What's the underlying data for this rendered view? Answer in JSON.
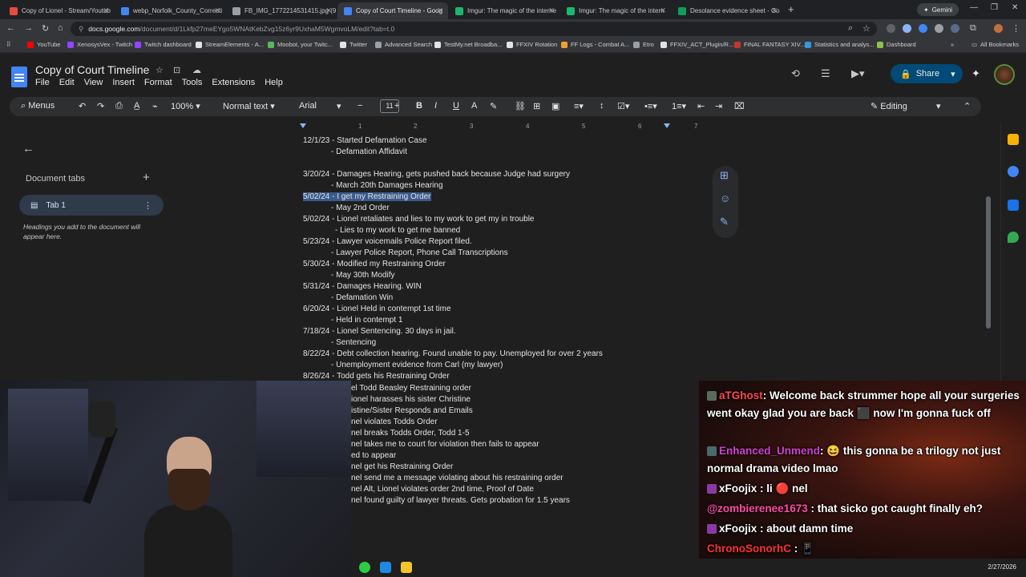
{
  "browser": {
    "tabs": [
      {
        "label": "Copy of Lionel - Stream/Youtub",
        "color": "#e74c3c"
      },
      {
        "label": "webp_Norfolk_County_Correcti",
        "color": "#4285f4"
      },
      {
        "label": "FB_IMG_1772214531415.jpg (9",
        "color": "#9aa0a6"
      },
      {
        "label": "Copy of Court Timeline - Goog",
        "color": "#4285f4"
      },
      {
        "label": "Imgur: The magic of the interne",
        "color": "#1bb76e"
      },
      {
        "label": "Imgur: The magic of the intern",
        "color": "#1bb76e"
      },
      {
        "label": "Desolance evidence sheet - Go",
        "color": "#0f9d58"
      }
    ],
    "new_tab": "+",
    "gemini_label": "Gemini",
    "url_domain": "docs.google.com",
    "url_path": "/document/d/1Lkfp27meEYgo5WNAtKebZvg15z6yr9UxhaM5WgmvoLM/edit?tab=t.0",
    "bookmarks": [
      {
        "label": "YouTube",
        "color": "#ff0000"
      },
      {
        "label": "XenosysVex - Twitch",
        "color": "#9146ff"
      },
      {
        "label": "Twitch dashboard",
        "color": "#9146ff"
      },
      {
        "label": "StreamElements - A...",
        "color": "#e3e3e3"
      },
      {
        "label": "Moobot, your Twitc...",
        "color": "#5cb85c"
      },
      {
        "label": "Twitter",
        "color": "#e3e3e3"
      },
      {
        "label": "Advanced Search",
        "color": "#9aa0a6"
      },
      {
        "label": "TestMy.net Broadba...",
        "color": "#e3e3e3"
      },
      {
        "label": "FFXIV Rotation",
        "color": "#e3e3e3"
      },
      {
        "label": "FF Logs - Combat A...",
        "color": "#f0a030"
      },
      {
        "label": "Etro",
        "color": "#9aa0a6"
      },
      {
        "label": "FFXIV_ACT_Plugin/R...",
        "color": "#e3e3e3"
      },
      {
        "label": "FINAL FANTASY XIV...",
        "color": "#c0392b"
      },
      {
        "label": "Statistics and analys...",
        "color": "#3498db"
      },
      {
        "label": "Dashboard",
        "color": "#8bc34a"
      }
    ],
    "all_bookmarks": "All Bookmarks"
  },
  "docs": {
    "title": "Copy of Court Timeline",
    "menu": [
      "File",
      "Edit",
      "View",
      "Insert",
      "Format",
      "Tools",
      "Extensions",
      "Help"
    ],
    "share_label": "Share",
    "toolbar": {
      "menus_label": "Menus",
      "zoom": "100%",
      "style": "Normal text",
      "font": "Arial",
      "font_size": "11",
      "mode": "Editing"
    },
    "ruler_numbers": [
      "1",
      "2",
      "3",
      "4",
      "5",
      "6",
      "7"
    ],
    "left_panel": {
      "heading": "Document tabs",
      "tab_name": "Tab 1",
      "help": "Headings you add to the document will appear here."
    },
    "lines": [
      "12/1/23 - Started Defamation Case",
      "- Defamation Affidavit",
      "",
      "3/20/24 - Damages Hearing, gets pushed back because Judge had surgery",
      "- March 20th Damages Hearing",
      "5/02/24 - I get my Restraining Order",
      "- May 2nd Order",
      "5/02/24 - Lionel retaliates and lies to my work to get my in trouble",
      "- Lies to my work to get me banned",
      "5/23/24 - Lawyer voicemails Police Report filed.",
      "- Lawyer Police Report, Phone Call Transcriptions",
      "5/30/24 - Modified my Restraining Order",
      "- May 30th Modify",
      "5/31/24 - Damages Hearing. WIN",
      "- Defamation Win",
      "6/20/24 - Lionel Held in contempt 1st time",
      "- Held in contempt 1",
      "7/18/24 - Lionel Sentencing. 30 days in jail.",
      "- Sentencing",
      "8/22/24 - Debt collection hearing. Found unable to pay. Unemployed for over 2 years",
      "- Unemployment evidence from Carl (my lawyer)",
      "8/26/24 - Todd gets his Restraining Order"
    ],
    "occluded_lines": [
      "el Todd Beasley Restraining order",
      "ionel harasses his sister Christine",
      "istine/Sister Responds and Emails",
      "nel violates Todds Order",
      "nel breaks Todds Order, Todd 1-5",
      "nel takes me to court for violation then fails to appear",
      "ed to appear",
      "nel get his Restraining Order",
      "nel send me a message violating about his restraining order",
      "nel Alt, Lionel violates order 2nd time, Proof of Date",
      "nel found guilty of lawyer threats. Gets probation for 1.5 years"
    ]
  },
  "chat": [
    {
      "user": "aTGhost",
      "color": "#ff4a4a",
      "text": "Welcome back strummer hope all your surgeries went okay glad you are back ⬛ now I'm gonna fuck off"
    },
    {
      "user": "Enhanced_Unmend",
      "color": "#d040d0",
      "text": "😆 this gonna be a trilogy not just normal drama video lmao"
    },
    {
      "user": "xFoojix",
      "color": "#ffffff",
      "text": "li 🔴 nel"
    },
    {
      "user": "@zombierenee1673",
      "color": "#ff4aa8",
      "text": "that sicko got caught finally eh?"
    },
    {
      "user": "xFoojix",
      "color": "#ffffff",
      "text": "about damn time"
    },
    {
      "user": "ChronoSonorhC",
      "color": "#ff3030",
      "text": "📱"
    }
  ],
  "taskbar": {
    "date": "2/27/2026"
  }
}
